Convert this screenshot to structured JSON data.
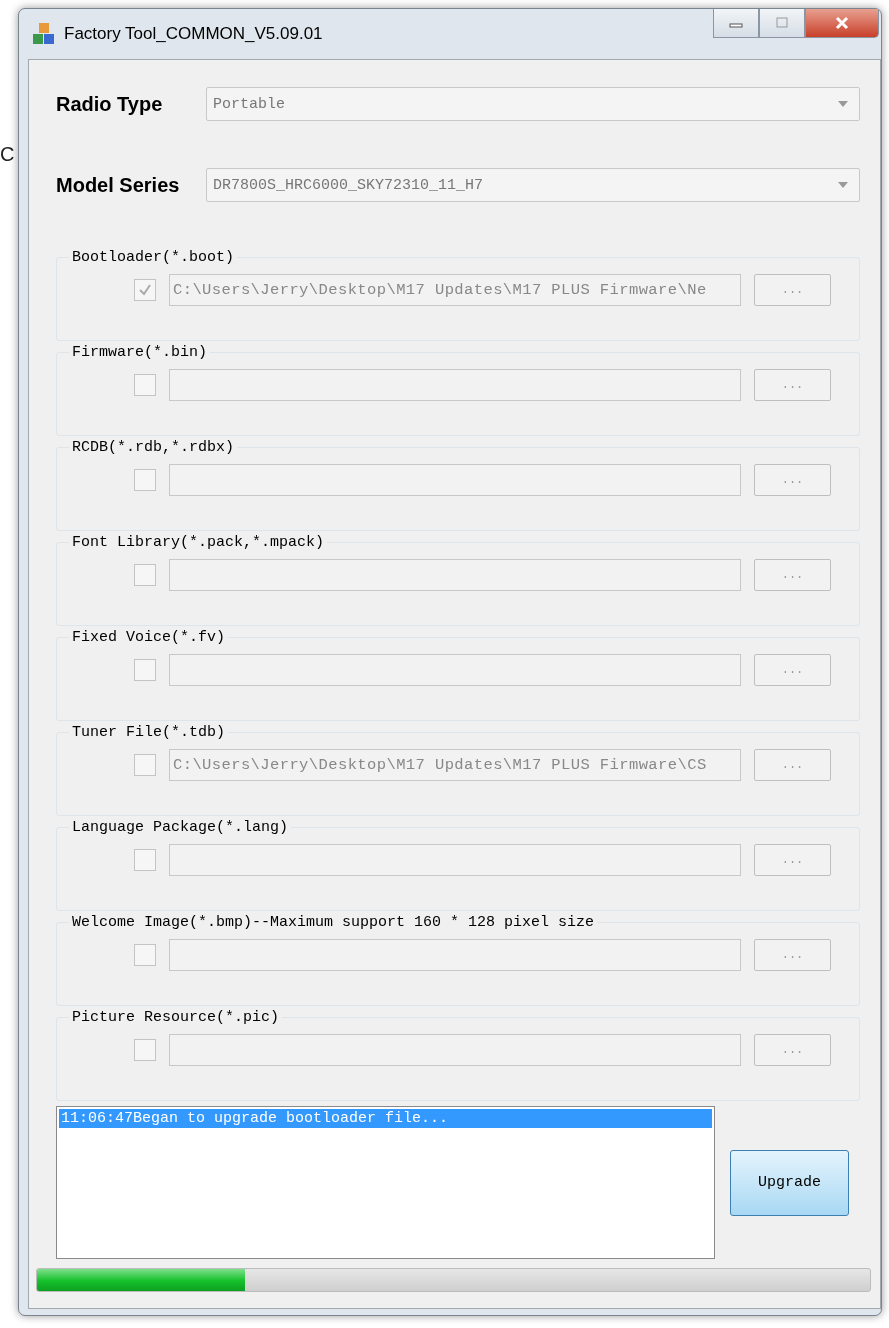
{
  "background_text": "C",
  "window": {
    "title": "Factory Tool_COMMON_V5.09.01"
  },
  "selectors": [
    {
      "label": "Radio Type",
      "value": "Portable"
    },
    {
      "label": "Model Series",
      "value": "DR7800S_HRC6000_SKY72310_11_H7"
    }
  ],
  "file_groups": [
    {
      "label": "Bootloader(*.boot)",
      "checked": true,
      "path": "C:\\Users\\Jerry\\Desktop\\M17 Updates\\M17 PLUS Firmware\\Ne",
      "browse": "..."
    },
    {
      "label": "Firmware(*.bin)",
      "checked": false,
      "browse": "..."
    },
    {
      "label": "RCDB(*.rdb,*.rdbx)",
      "checked": false,
      "browse": "..."
    },
    {
      "label": "Font Library(*.pack,*.mpack)",
      "checked": false,
      "browse": "..."
    },
    {
      "label": "Fixed Voice(*.fv)",
      "checked": false,
      "browse": "..."
    },
    {
      "label": "Tuner File(*.tdb)",
      "checked": false,
      "path": "C:\\Users\\Jerry\\Desktop\\M17 Updates\\M17 PLUS Firmware\\CS",
      "browse": "..."
    },
    {
      "label": "Language Package(*.lang)",
      "checked": false,
      "browse": "..."
    },
    {
      "label": "Welcome Image(*.bmp)--Maximum support 160 * 128 pixel size",
      "checked": false,
      "browse": "..."
    },
    {
      "label": "Picture Resource(*.pic)",
      "checked": false,
      "browse": "..."
    }
  ],
  "log": [
    {
      "text": "11:06:47Began to upgrade bootloader file...",
      "selected": true
    }
  ],
  "upgrade_button": "Upgrade",
  "progress": {
    "level": 0.25
  }
}
